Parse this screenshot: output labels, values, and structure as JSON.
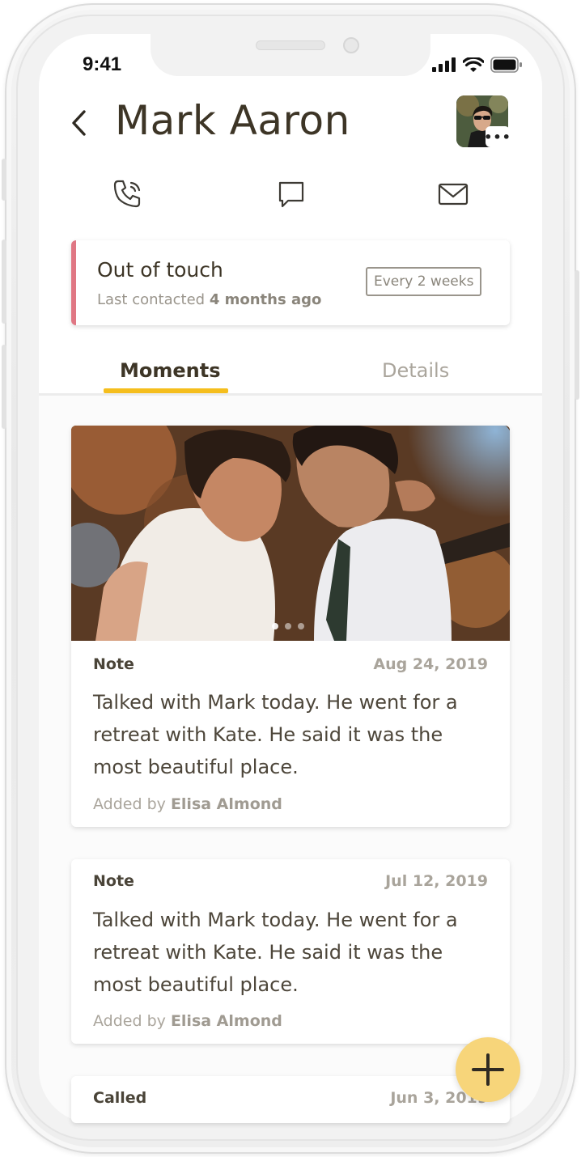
{
  "status_bar": {
    "time": "9:41"
  },
  "header": {
    "title": "Mark Aaron"
  },
  "avatar": {
    "more_label": "•••"
  },
  "actions": [
    {
      "icon": "phone-icon"
    },
    {
      "icon": "chat-bubble-icon"
    },
    {
      "icon": "mail-icon"
    }
  ],
  "contact_status": {
    "title": "Out of touch",
    "last_contacted_prefix": "Last contacted",
    "last_contacted_value": "4 months ago",
    "frequency": "Every 2 weeks",
    "accent_color": "#e07784"
  },
  "tabs": [
    {
      "label": "Moments",
      "active": true
    },
    {
      "label": "Details",
      "active": false
    }
  ],
  "moments": [
    {
      "type": "Note",
      "date": "Aug 24, 2019",
      "body": "Talked with Mark today. He went for a retreat with Kate. He said it was the most beautiful place.",
      "added_prefix": "Added by",
      "added_by": "Elisa Almond",
      "has_photo": true
    },
    {
      "type": "Note",
      "date": "Jul 12, 2019",
      "body": "Talked with Mark today. He went for a retreat with Kate. He said it was the most beautiful place.",
      "added_prefix": "Added by",
      "added_by": "Elisa Almond",
      "has_photo": false
    },
    {
      "type": "Called",
      "date": "Jun 3, 2019"
    }
  ],
  "colors": {
    "tab_accent": "#f5be1d",
    "fab": "#f7d57a"
  },
  "fab": {
    "icon": "plus-icon"
  }
}
